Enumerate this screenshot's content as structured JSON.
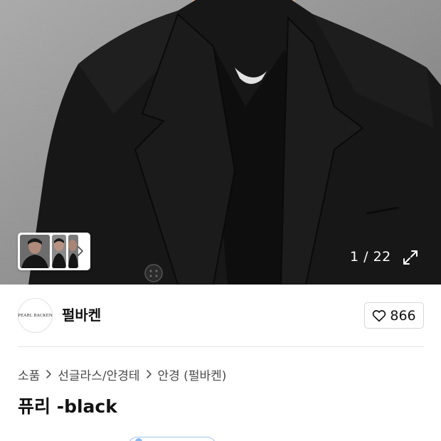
{
  "gallery": {
    "current_index": "1",
    "total": "22",
    "counter_text": "1 / 22"
  },
  "seller": {
    "avatar_text": "PEARL BACKEN",
    "name": "펄바켄",
    "likes": "866"
  },
  "breadcrumb": {
    "items": [
      "소품",
      "선글라스/안경테",
      "안경 (펄바켄)"
    ]
  },
  "product": {
    "title": "퓨리 -black"
  },
  "icons": {
    "thumb_next": "chevron-right-icon",
    "expand": "expand-icon",
    "like": "heart-outline-icon",
    "crumb_separator": "chevron-right-icon"
  },
  "colors": {
    "text_primary": "#111111",
    "text_secondary": "#4a4a4a",
    "border": "#d6d6d6",
    "divider": "#e4e4e4"
  }
}
